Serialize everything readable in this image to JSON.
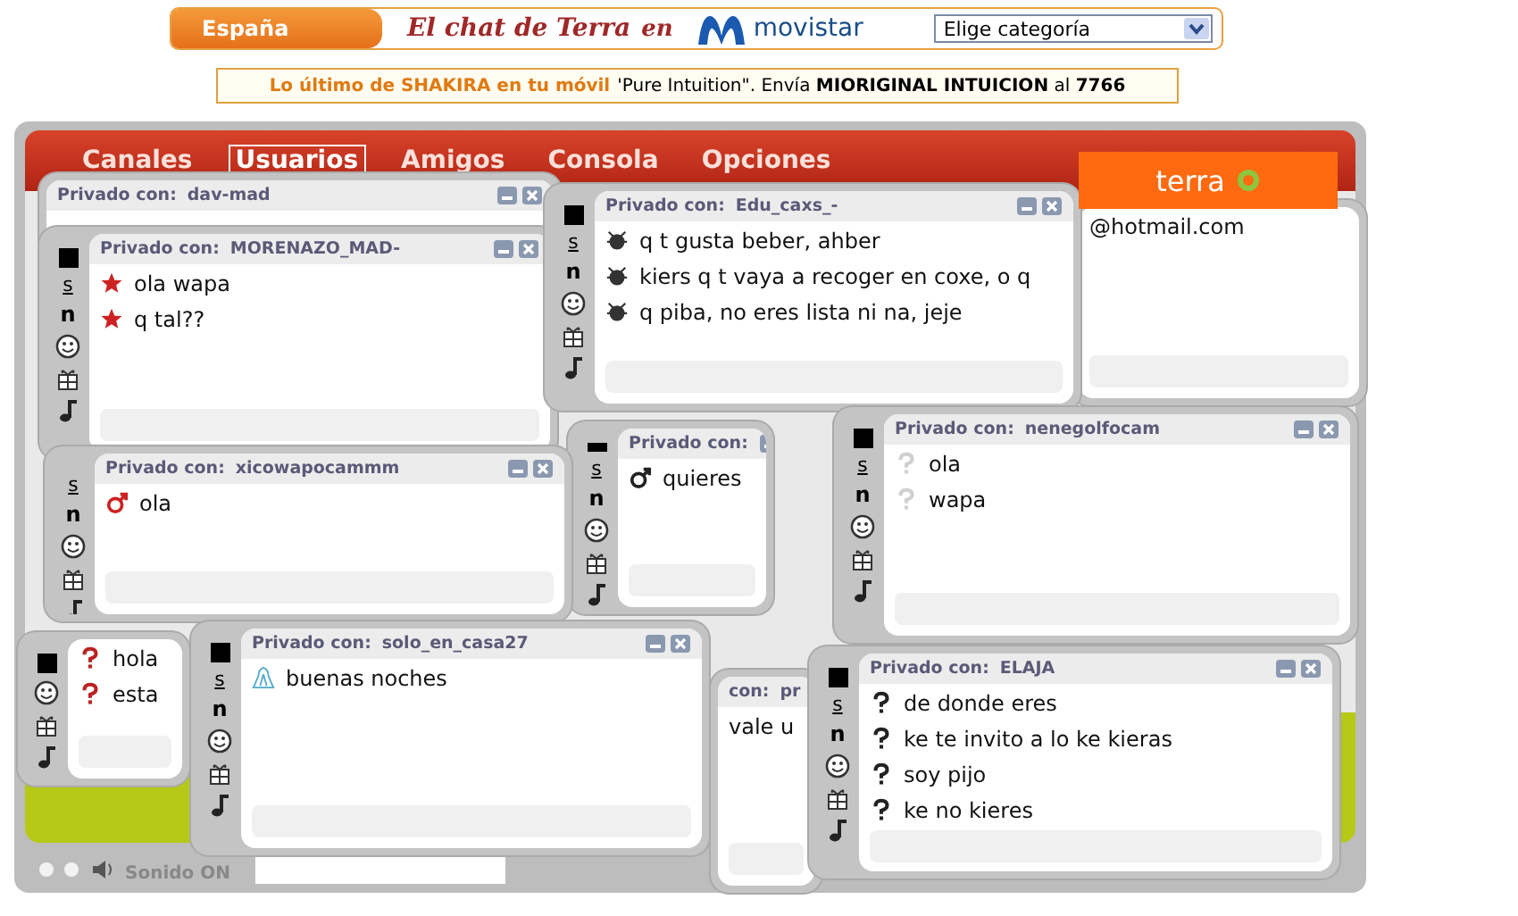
{
  "header": {
    "region": "España",
    "tagline": "El chat de Terra",
    "tagline_en": "en",
    "brand": "movistar",
    "category_select": "Elige categoría"
  },
  "promo": {
    "highlight": "Lo último de SHAKIRA en tu móvil",
    "text": "'Pure Intuition\". Envía **MIORIGINAL INTUICION** al **7766**"
  },
  "menu": [
    {
      "label": "Canales",
      "selected": false
    },
    {
      "label": "Usuarios",
      "selected": true
    },
    {
      "label": "Amigos",
      "selected": false
    },
    {
      "label": "Consola",
      "selected": false
    },
    {
      "label": "Opciones",
      "selected": false
    }
  ],
  "logo": "terra",
  "sound": "Sonido ON",
  "windows": [
    {
      "title_label": "Privado con:",
      "user": "dav-mad"
    },
    {
      "messages": [
        "@hotmail.com"
      ]
    },
    {
      "title_label": "Privado con:",
      "user": "MORENAZO_MAD-",
      "tools": [
        "s",
        "n"
      ],
      "avatar": {
        "kind": "star",
        "color": "#cc2222"
      },
      "messages": [
        "ola wapa",
        "q tal??"
      ]
    },
    {
      "title_label": "Privado con:",
      "user": "Edu_caxs_-",
      "tools": [
        "s",
        "n"
      ],
      "avatar": {
        "kind": "bug",
        "color": "#333333"
      },
      "messages": [
        "q t gusta beber, ahber",
        "kiers q t vaya a recoger en coxe, o q",
        "q piba, no eres lista ni na, jeje"
      ]
    },
    {
      "title_label": "Privado con:",
      "tools": [
        "s",
        "n"
      ],
      "avatar": {
        "kind": "male",
        "color": "#222222"
      },
      "messages": [
        "quieres"
      ]
    },
    {
      "title_label": "Privado con:",
      "user": "xicowapocammm",
      "tools": [
        "s",
        "n"
      ],
      "avatar": {
        "kind": "male",
        "color": "#cc2222"
      },
      "messages": [
        "ola"
      ]
    },
    {
      "avatar": {
        "kind": "question",
        "color": "#bb2222"
      },
      "messages": [
        "hola",
        "esta"
      ]
    },
    {
      "title_label": "Privado con:",
      "user": "solo_en_casa27",
      "tools": [
        "s",
        "n"
      ],
      "avatar": {
        "kind": "penguin",
        "color": "#55aacc"
      },
      "messages": [
        "buenas noches"
      ]
    },
    {
      "title_label": "con:",
      "user": "pr",
      "messages": [
        "vale u"
      ]
    },
    {
      "title_label": "Privado con:",
      "user": "nenegolfocam",
      "tools": [
        "s",
        "n"
      ],
      "avatar": {
        "kind": "question",
        "color": "#d0d0d0"
      },
      "messages": [
        "ola",
        "wapa"
      ]
    },
    {
      "title_label": "Privado con:",
      "user": "ELAJA",
      "tools": [
        "s",
        "n"
      ],
      "avatar": {
        "kind": "question",
        "color": "#222222"
      },
      "messages": [
        "de donde eres",
        "ke te invito a lo ke kieras",
        "soy pijo",
        "ke no kieres"
      ]
    }
  ]
}
